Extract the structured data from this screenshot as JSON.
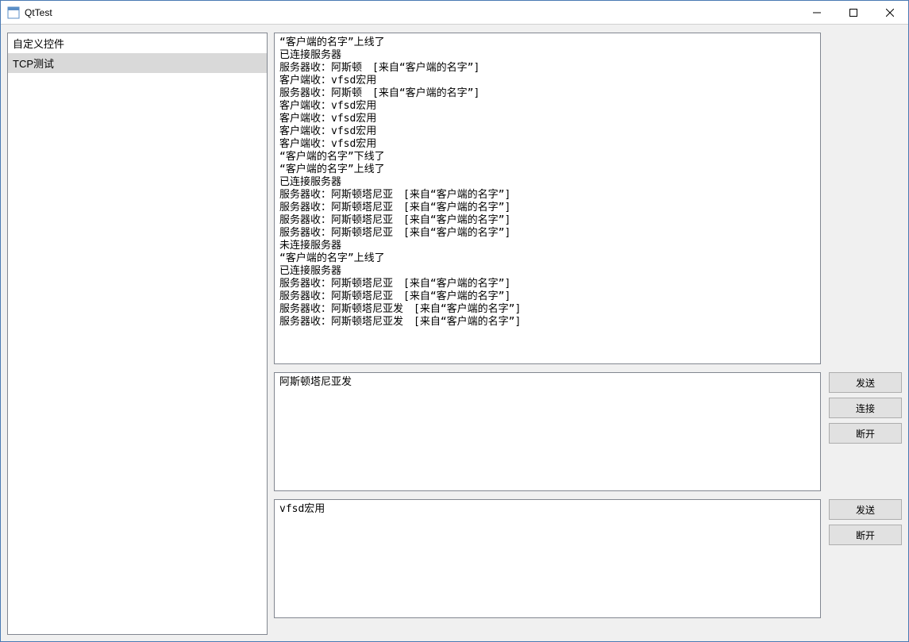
{
  "window": {
    "title": "QtTest"
  },
  "sidebar": {
    "items": [
      {
        "label": "自定义控件",
        "selected": false
      },
      {
        "label": "TCP测试",
        "selected": true
      }
    ]
  },
  "log": {
    "lines": [
      "“客户端的名字”上线了",
      "已连接服务器",
      "服务器收：阿斯顿　[来自“客户端的名字”]",
      "客户端收：vfsd宏用",
      "服务器收：阿斯顿　[来自“客户端的名字”]",
      "客户端收：vfsd宏用",
      "客户端收：vfsd宏用",
      "客户端收：vfsd宏用",
      "客户端收：vfsd宏用",
      "“客户端的名字”下线了",
      "“客户端的名字”上线了",
      "已连接服务器",
      "服务器收：阿斯顿塔尼亚　[来自“客户端的名字”]",
      "服务器收：阿斯顿塔尼亚　[来自“客户端的名字”]",
      "服务器收：阿斯顿塔尼亚　[来自“客户端的名字”]",
      "服务器收：阿斯顿塔尼亚　[来自“客户端的名字”]",
      "未连接服务器",
      "“客户端的名字”上线了",
      "已连接服务器",
      "服务器收：阿斯顿塔尼亚　[来自“客户端的名字”]",
      "服务器收：阿斯顿塔尼亚　[来自“客户端的名字”]",
      "服务器收：阿斯顿塔尼亚发　[来自“客户端的名字”]",
      "服务器收：阿斯顿塔尼亚发　[来自“客户端的名字”]"
    ]
  },
  "server_panel": {
    "input_value": "阿斯顿塔尼亚发",
    "buttons": {
      "send": "发送",
      "connect": "连接",
      "disconnect": "断开"
    }
  },
  "client_panel": {
    "input_value": "vfsd宏用",
    "buttons": {
      "send": "发送",
      "disconnect": "断开"
    }
  }
}
